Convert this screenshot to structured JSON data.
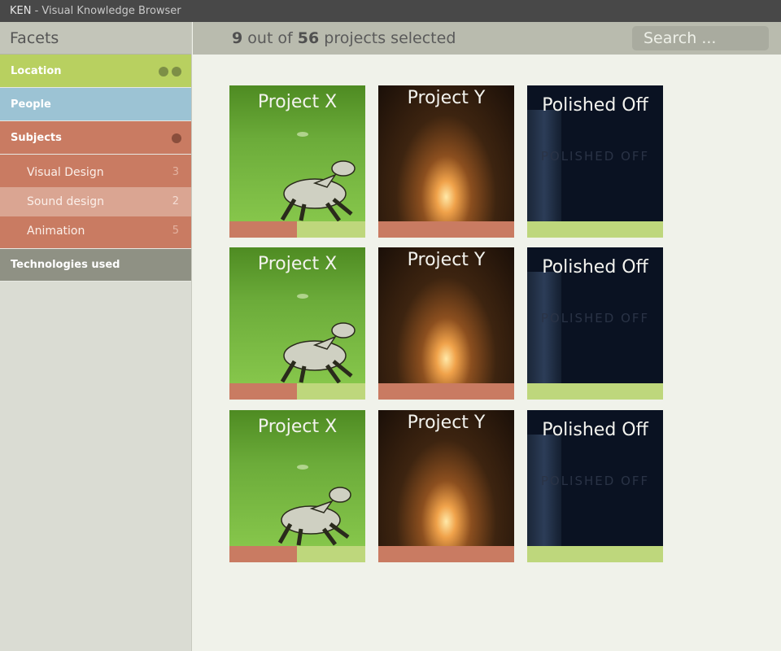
{
  "app": {
    "name": "KEN",
    "subtitle": " - Visual Knowledge Browser"
  },
  "sidebar": {
    "header": "Facets",
    "facets": [
      {
        "label": "Location"
      },
      {
        "label": "People"
      },
      {
        "label": "Subjects"
      },
      {
        "label": "Technologies used"
      }
    ],
    "subjects": [
      {
        "label": "Visual Design",
        "count": "3"
      },
      {
        "label": "Sound design",
        "count": "2"
      },
      {
        "label": "Animation",
        "count": "5"
      }
    ]
  },
  "header": {
    "selected": "9",
    "out_of": " out of ",
    "total": "56",
    "suffix": " projects selected",
    "search_placeholder": "Search ..."
  },
  "projects": [
    {
      "title": "Project X",
      "watermark": ""
    },
    {
      "title": "Project Y",
      "watermark": ""
    },
    {
      "title": "Polished Off",
      "watermark": "POLISHED OFF"
    },
    {
      "title": "Project X",
      "watermark": ""
    },
    {
      "title": "Project Y",
      "watermark": ""
    },
    {
      "title": "Polished Off",
      "watermark": "POLISHED OFF"
    },
    {
      "title": "Project X",
      "watermark": ""
    },
    {
      "title": "Project Y",
      "watermark": ""
    },
    {
      "title": "Polished Off",
      "watermark": "POLISHED OFF"
    }
  ],
  "colors": {
    "location": "#b8d060",
    "people": "#9cc3d4",
    "subjects": "#c97b62",
    "technologies": "#8f9184"
  }
}
